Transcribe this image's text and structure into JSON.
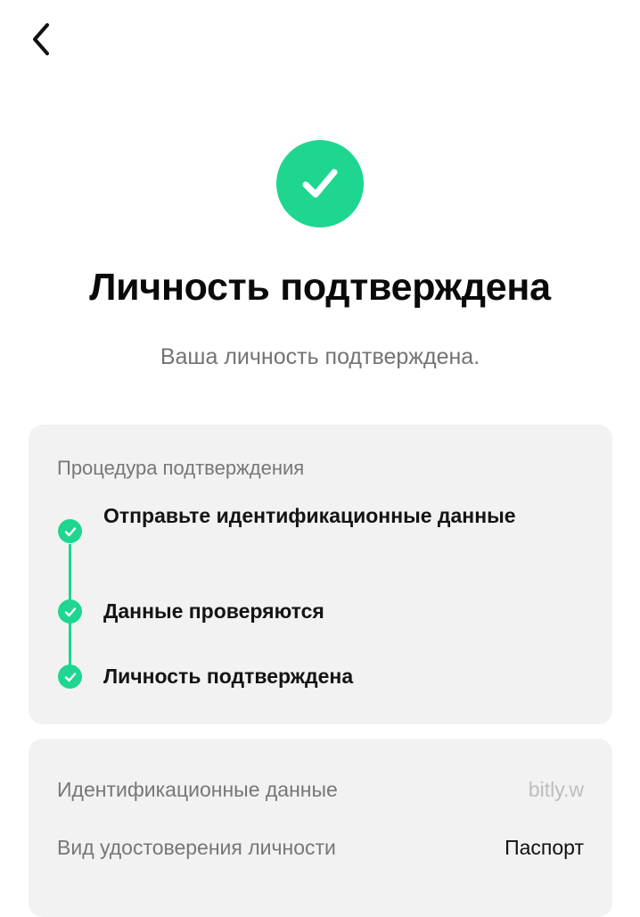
{
  "header": {
    "back_icon": "chevron-left-icon"
  },
  "status": {
    "icon": "check-circle-icon",
    "color": "#1ED68F",
    "title": "Личность подтверждена",
    "subtitle": "Ваша личность подтверждена."
  },
  "procedure": {
    "header": "Процедура подтверждения",
    "steps": [
      {
        "label": "Отправьте идентификационные данные",
        "done": true
      },
      {
        "label": "Данные проверяются",
        "done": true
      },
      {
        "label": "Личность подтверждена",
        "done": true
      }
    ]
  },
  "details": {
    "rows": [
      {
        "label": "Идентификационные данные",
        "value": "bitly.w"
      },
      {
        "label": "Вид удостоверения личности",
        "value": "Паспорт"
      }
    ]
  }
}
